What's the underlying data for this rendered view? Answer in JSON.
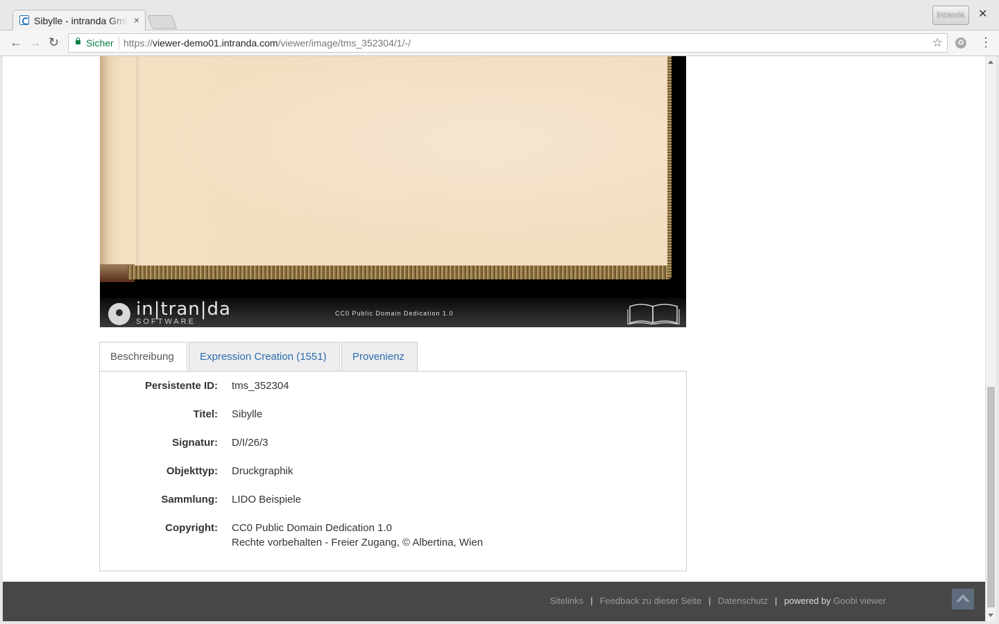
{
  "browser": {
    "tab_title": "Sibylle - intranda GmbH",
    "tab_close": "×",
    "profile_label": "intranda",
    "window_close": "✕",
    "secure_label": "Sicher",
    "url_scheme": "https://",
    "url_host": "viewer-demo01.intranda.com",
    "url_path": "/viewer/image/tms_352304/1/-/",
    "back_glyph": "←",
    "forward_glyph": "→",
    "reload_glyph": "↻",
    "star_glyph": "☆",
    "ext_glyph": "♻",
    "menu_glyph": "⋮",
    "icons": [
      "tab-favicon",
      "close-icon",
      "back-icon",
      "forward-icon",
      "reload-icon",
      "lock-icon",
      "star-icon",
      "extension-icon",
      "menu-icon"
    ]
  },
  "viewer": {
    "logo_name": "in|tran|da",
    "logo_sub": "SOFTWARE",
    "license": "CC0 Public Domain Dedication 1.0"
  },
  "tabs": [
    {
      "label": "Beschreibung",
      "active": true
    },
    {
      "label": "Expression Creation (1551)",
      "active": false
    },
    {
      "label": "Provenienz",
      "active": false
    }
  ],
  "metadata": [
    {
      "label": "Persistente ID:",
      "value": "tms_352304"
    },
    {
      "label": "Titel:",
      "value": "Sibylle"
    },
    {
      "label": "Signatur:",
      "value": "D/I/26/3"
    },
    {
      "label": "Objekttyp:",
      "value": "Druckgraphik"
    },
    {
      "label": "Sammlung:",
      "value": "LIDO Beispiele"
    },
    {
      "label": "Copyright:",
      "value": "CC0 Public Domain Dedication 1.0",
      "value2": "Rechte vorbehalten - Freier Zugang, © Albertina, Wien"
    }
  ],
  "footer": {
    "sitelinks": "Sitelinks",
    "feedback": "Feedback zu dieser Seite",
    "privacy": "Datenschutz",
    "sep": "|",
    "powered_by": "powered by",
    "goobi": "Goobi viewer"
  },
  "colors": {
    "link": "#2a6bb0",
    "footer_bg": "#474747",
    "secure_green": "#0b8043"
  }
}
